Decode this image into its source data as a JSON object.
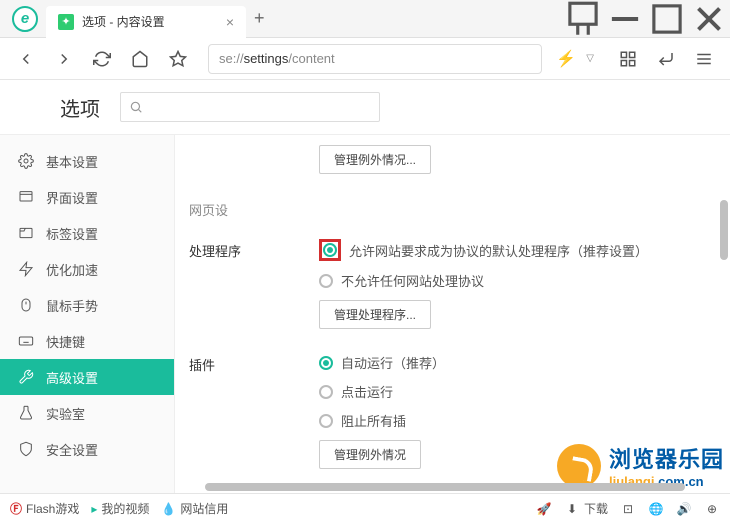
{
  "titlebar": {
    "tab_title": "选项 - 内容设置"
  },
  "toolbar": {
    "url_prefix": "se://",
    "url_mid": "settings",
    "url_suffix": "/content"
  },
  "page": {
    "title": "选项"
  },
  "sidebar": {
    "items": [
      {
        "label": "基本设置"
      },
      {
        "label": "界面设置"
      },
      {
        "label": "标签设置"
      },
      {
        "label": "优化加速"
      },
      {
        "label": "鼠标手势"
      },
      {
        "label": "快捷键"
      },
      {
        "label": "高级设置"
      },
      {
        "label": "实验室"
      },
      {
        "label": "安全设置"
      }
    ]
  },
  "settings": {
    "top_button": "管理例外情况...",
    "section_label": "网页设",
    "handler": {
      "title": "处理程序",
      "opt1": "允许网站要求成为协议的默认处理程序（推荐设置）",
      "opt2": "不允许任何网站处理协议",
      "btn": "管理处理程序..."
    },
    "plugin": {
      "title": "插件",
      "opt1": "自动运行（推荐）",
      "opt2": "点击运行",
      "opt3": "阻止所有插",
      "btn": "管理例外情况"
    }
  },
  "statusbar": {
    "flash": "Flash游戏",
    "video": "我的视频",
    "trust": "网站信用",
    "download": "下载"
  },
  "watermark": {
    "cn": "浏览器乐园",
    "en1": "liulanqi",
    "en2": ".com.cn"
  }
}
